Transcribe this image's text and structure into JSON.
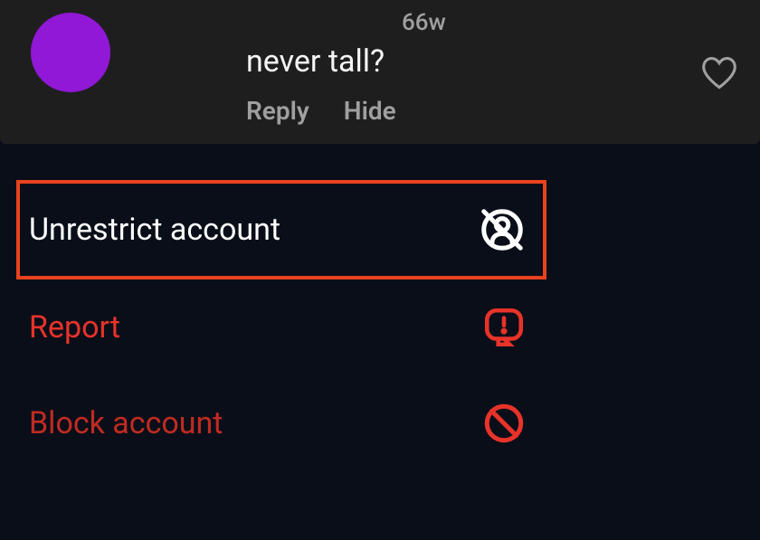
{
  "comment": {
    "timestamp": "66w",
    "text": "never tall?",
    "reply_label": "Reply",
    "hide_label": "Hide"
  },
  "menu": {
    "unrestrict_label": "Unrestrict account",
    "report_label": "Report",
    "block_label": "Block account"
  },
  "colors": {
    "avatar": "#9018d6",
    "highlight": "#e8421f",
    "red": "#e8332a"
  }
}
